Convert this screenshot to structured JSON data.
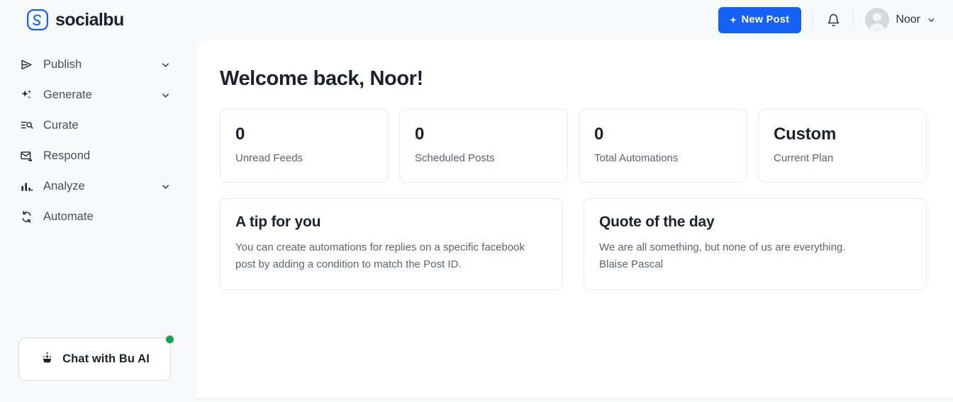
{
  "brand": {
    "name": "socialbu",
    "logo_icon": "socialbu-s-logo-icon",
    "logo_color": "#1560f5"
  },
  "header": {
    "new_post_label": "New Post",
    "new_post_plus": "+",
    "new_post_color": "#1560f5",
    "notifications_icon": "bell-icon",
    "user": {
      "name": "Noor",
      "avatar_icon": "avatar-placeholder-icon",
      "chevron_icon": "chevron-down-icon"
    }
  },
  "sidebar": {
    "items": [
      {
        "label": "Publish",
        "icon": "send-icon",
        "expandable": true
      },
      {
        "label": "Generate",
        "icon": "sparkles-icon",
        "expandable": true
      },
      {
        "label": "Curate",
        "icon": "list-search-icon",
        "expandable": false
      },
      {
        "label": "Respond",
        "icon": "mail-reply-icon",
        "expandable": false
      },
      {
        "label": "Analyze",
        "icon": "bar-chart-icon",
        "expandable": true
      },
      {
        "label": "Automate",
        "icon": "refresh-cycle-icon",
        "expandable": false
      }
    ],
    "chat": {
      "label": "Chat with Bu AI",
      "icon": "bu-ai-icon",
      "status_color": "#16a34a"
    }
  },
  "main": {
    "title": "Welcome back, Noor!",
    "stats": [
      {
        "value": "0",
        "label": "Unread Feeds"
      },
      {
        "value": "0",
        "label": "Scheduled Posts"
      },
      {
        "value": "0",
        "label": "Total Automations"
      },
      {
        "value": "Custom",
        "label": "Current Plan"
      }
    ],
    "tip": {
      "title": "A tip for you",
      "body": "You can create automations for replies on a specific facebook post by adding a condition to match the Post ID."
    },
    "quote": {
      "title": "Quote of the day",
      "body": "We are all something, but none of us are everything.",
      "author": "Blaise Pascal"
    }
  }
}
